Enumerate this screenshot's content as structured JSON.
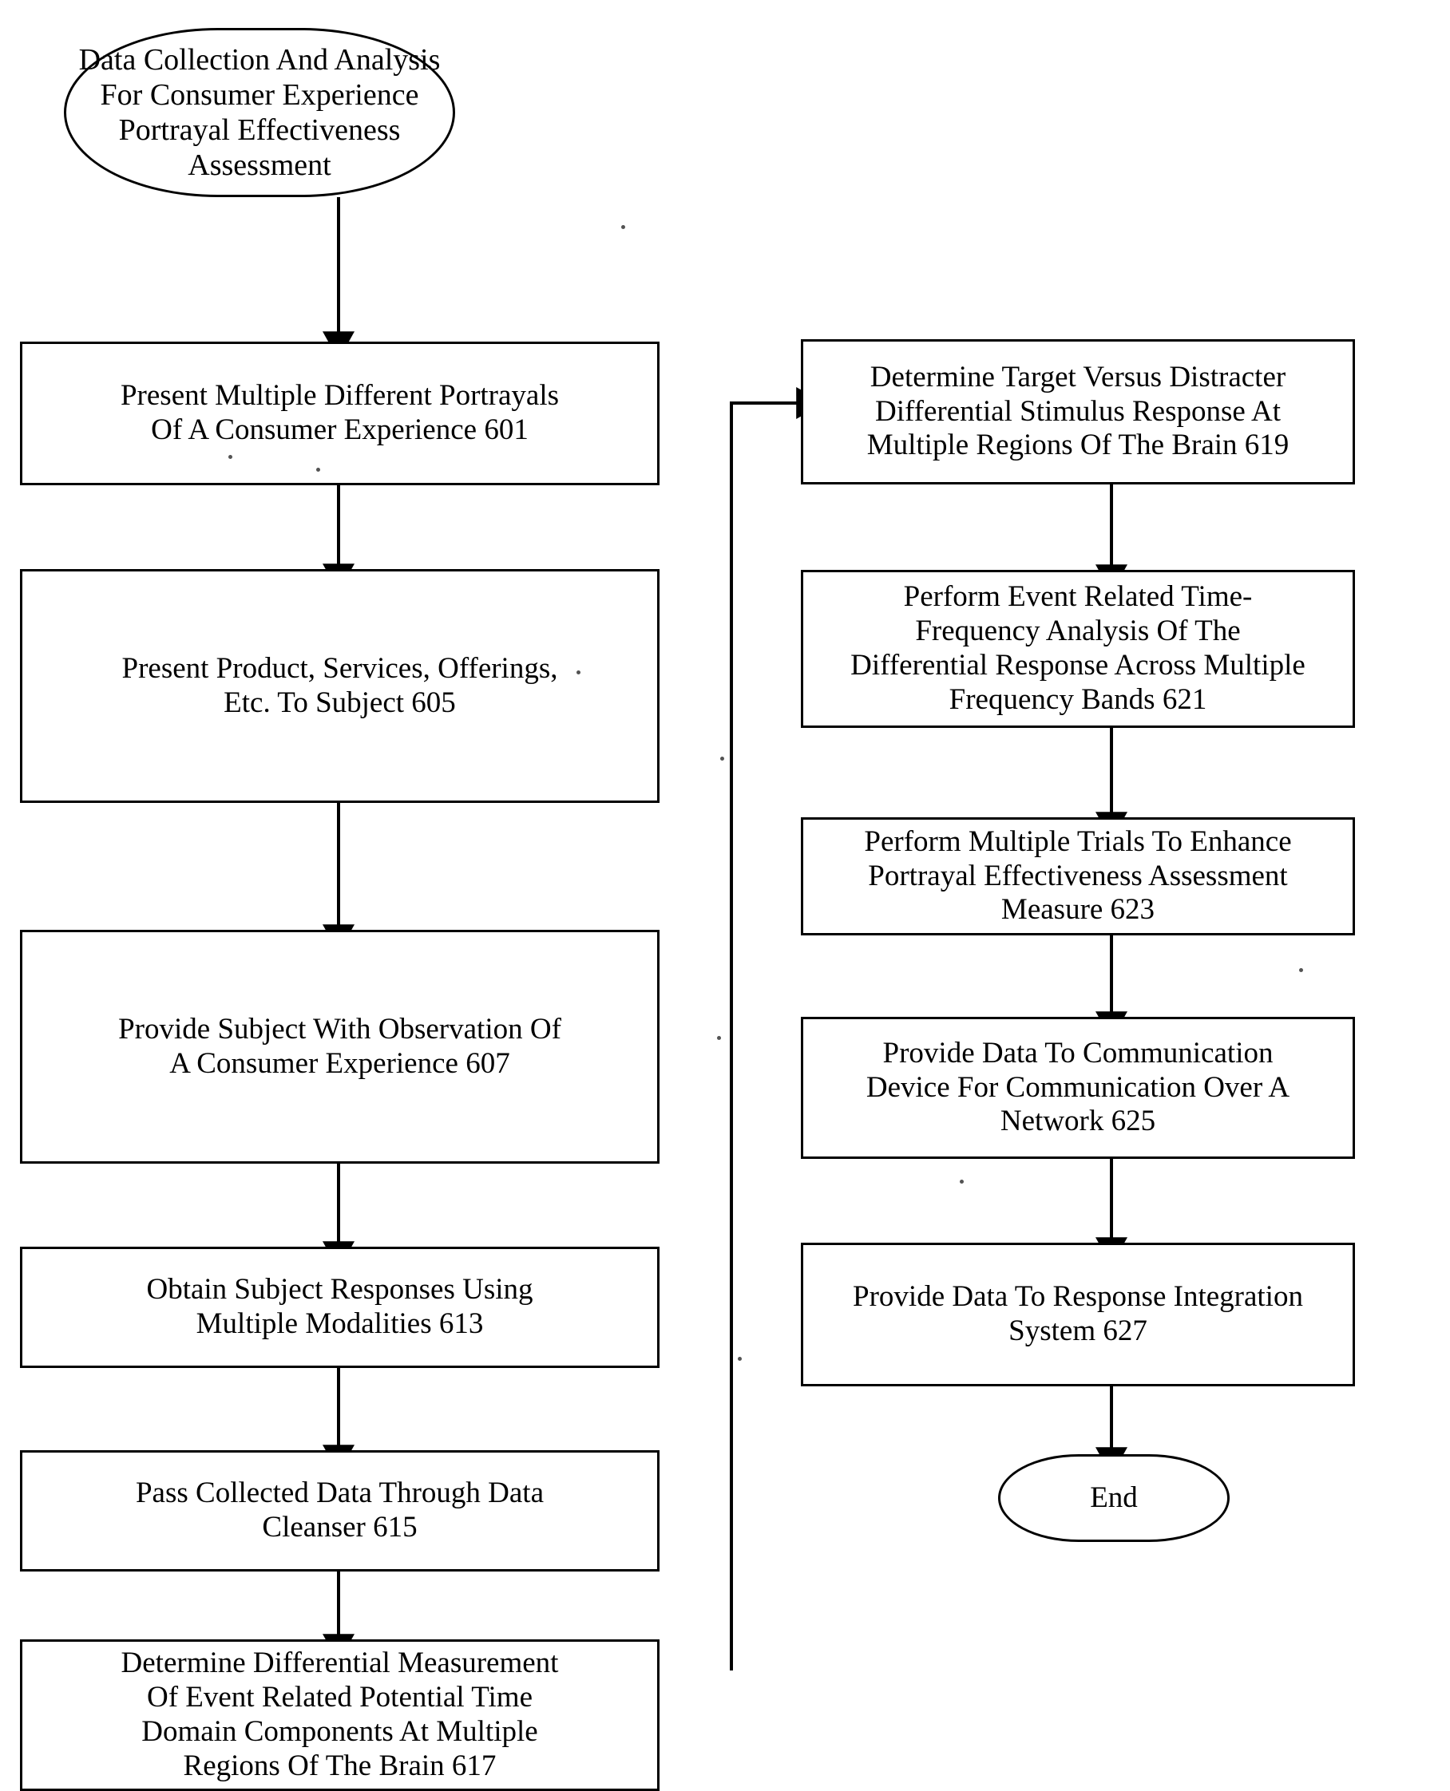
{
  "diagram": {
    "type": "flowchart",
    "title": "Data Collection And Analysis For Consumer Experience Portrayal Effectiveness Assessment",
    "orientation": "two-column, top-to-bottom, left column then right column",
    "nodes": [
      {
        "id": "start",
        "shape": "terminator",
        "label": "Data Collection And Analysis\nFor Consumer Experience\nPortrayal Effectiveness\nAssessment",
        "ref": ""
      },
      {
        "id": "n601",
        "shape": "process",
        "label": "Present Multiple Different Portrayals\nOf A Consumer Experience 601",
        "ref": "601"
      },
      {
        "id": "n605",
        "shape": "process",
        "label": "Present Product, Services, Offerings,\nEtc. To Subject 605",
        "ref": "605"
      },
      {
        "id": "n607",
        "shape": "process",
        "label": "Provide Subject With Observation Of\nA Consumer Experience 607",
        "ref": "607"
      },
      {
        "id": "n613",
        "shape": "process",
        "label": "Obtain Subject Responses Using\nMultiple Modalities 613",
        "ref": "613"
      },
      {
        "id": "n615",
        "shape": "process",
        "label": "Pass Collected Data Through Data\nCleanser 615",
        "ref": "615"
      },
      {
        "id": "n617",
        "shape": "process",
        "label": "Determine Differential Measurement\nOf Event Related Potential Time\nDomain Components At Multiple\nRegions Of The Brain 617",
        "ref": "617"
      },
      {
        "id": "n619",
        "shape": "process",
        "label": "Determine Target Versus Distracter\nDifferential Stimulus Response At\nMultiple Regions Of The Brain 619",
        "ref": "619"
      },
      {
        "id": "n621",
        "shape": "process",
        "label": "Perform Event Related Time-\nFrequency Analysis Of The\nDifferential Response Across Multiple\nFrequency Bands 621",
        "ref": "621"
      },
      {
        "id": "n623",
        "shape": "process",
        "label": "Perform Multiple Trials To Enhance\nPortrayal Effectiveness Assessment\nMeasure 623",
        "ref": "623"
      },
      {
        "id": "n625",
        "shape": "process",
        "label": "Provide Data To Communication\nDevice For Communication Over A\nNetwork 625",
        "ref": "625"
      },
      {
        "id": "n627",
        "shape": "process",
        "label": "Provide Data To Response Integration\nSystem 627",
        "ref": "627"
      },
      {
        "id": "end",
        "shape": "terminator",
        "label": "End",
        "ref": ""
      }
    ],
    "edges": [
      {
        "from": "start",
        "to": "n601",
        "style": "straight-down-arrow"
      },
      {
        "from": "n601",
        "to": "n605",
        "style": "straight-down-arrow"
      },
      {
        "from": "n605",
        "to": "n607",
        "style": "straight-down-arrow"
      },
      {
        "from": "n607",
        "to": "n613",
        "style": "straight-down-arrow"
      },
      {
        "from": "n613",
        "to": "n615",
        "style": "straight-down-arrow"
      },
      {
        "from": "n615",
        "to": "n617",
        "style": "straight-down-arrow"
      },
      {
        "from": "n617",
        "to": "n619",
        "style": "right-up-right-arrow (column transfer)"
      },
      {
        "from": "n619",
        "to": "n621",
        "style": "straight-down-arrow"
      },
      {
        "from": "n621",
        "to": "n623",
        "style": "straight-down-arrow"
      },
      {
        "from": "n623",
        "to": "n625",
        "style": "straight-down-arrow"
      },
      {
        "from": "n625",
        "to": "n627",
        "style": "straight-down-arrow"
      },
      {
        "from": "n627",
        "to": "end",
        "style": "straight-down-arrow"
      }
    ],
    "colors": {
      "stroke": "#000000",
      "fill": "#ffffff",
      "text": "#000000"
    }
  }
}
